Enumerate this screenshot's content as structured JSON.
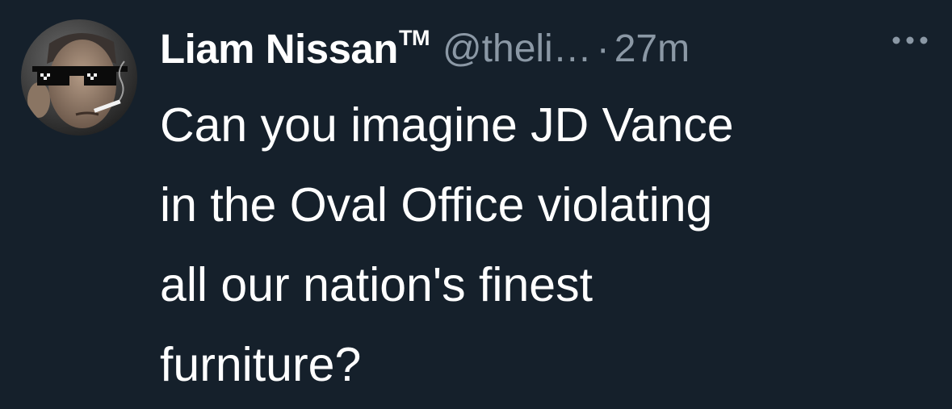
{
  "tweet": {
    "author": {
      "display_name": "Liam Nissan",
      "trademark": "TM",
      "handle": "@theli…",
      "avatar_icon": "avatar-photo-sunglasses-cigarette"
    },
    "separator": "·",
    "timestamp": "27m",
    "more_icon": "more-horizontal-icon",
    "text": "Can you imagine JD Vance\nin the Oval Office violating\nall our nation's finest\nfurniture?"
  },
  "colors": {
    "background": "#15202b",
    "primary_text": "#ffffff",
    "secondary_text": "#8b98a5"
  }
}
